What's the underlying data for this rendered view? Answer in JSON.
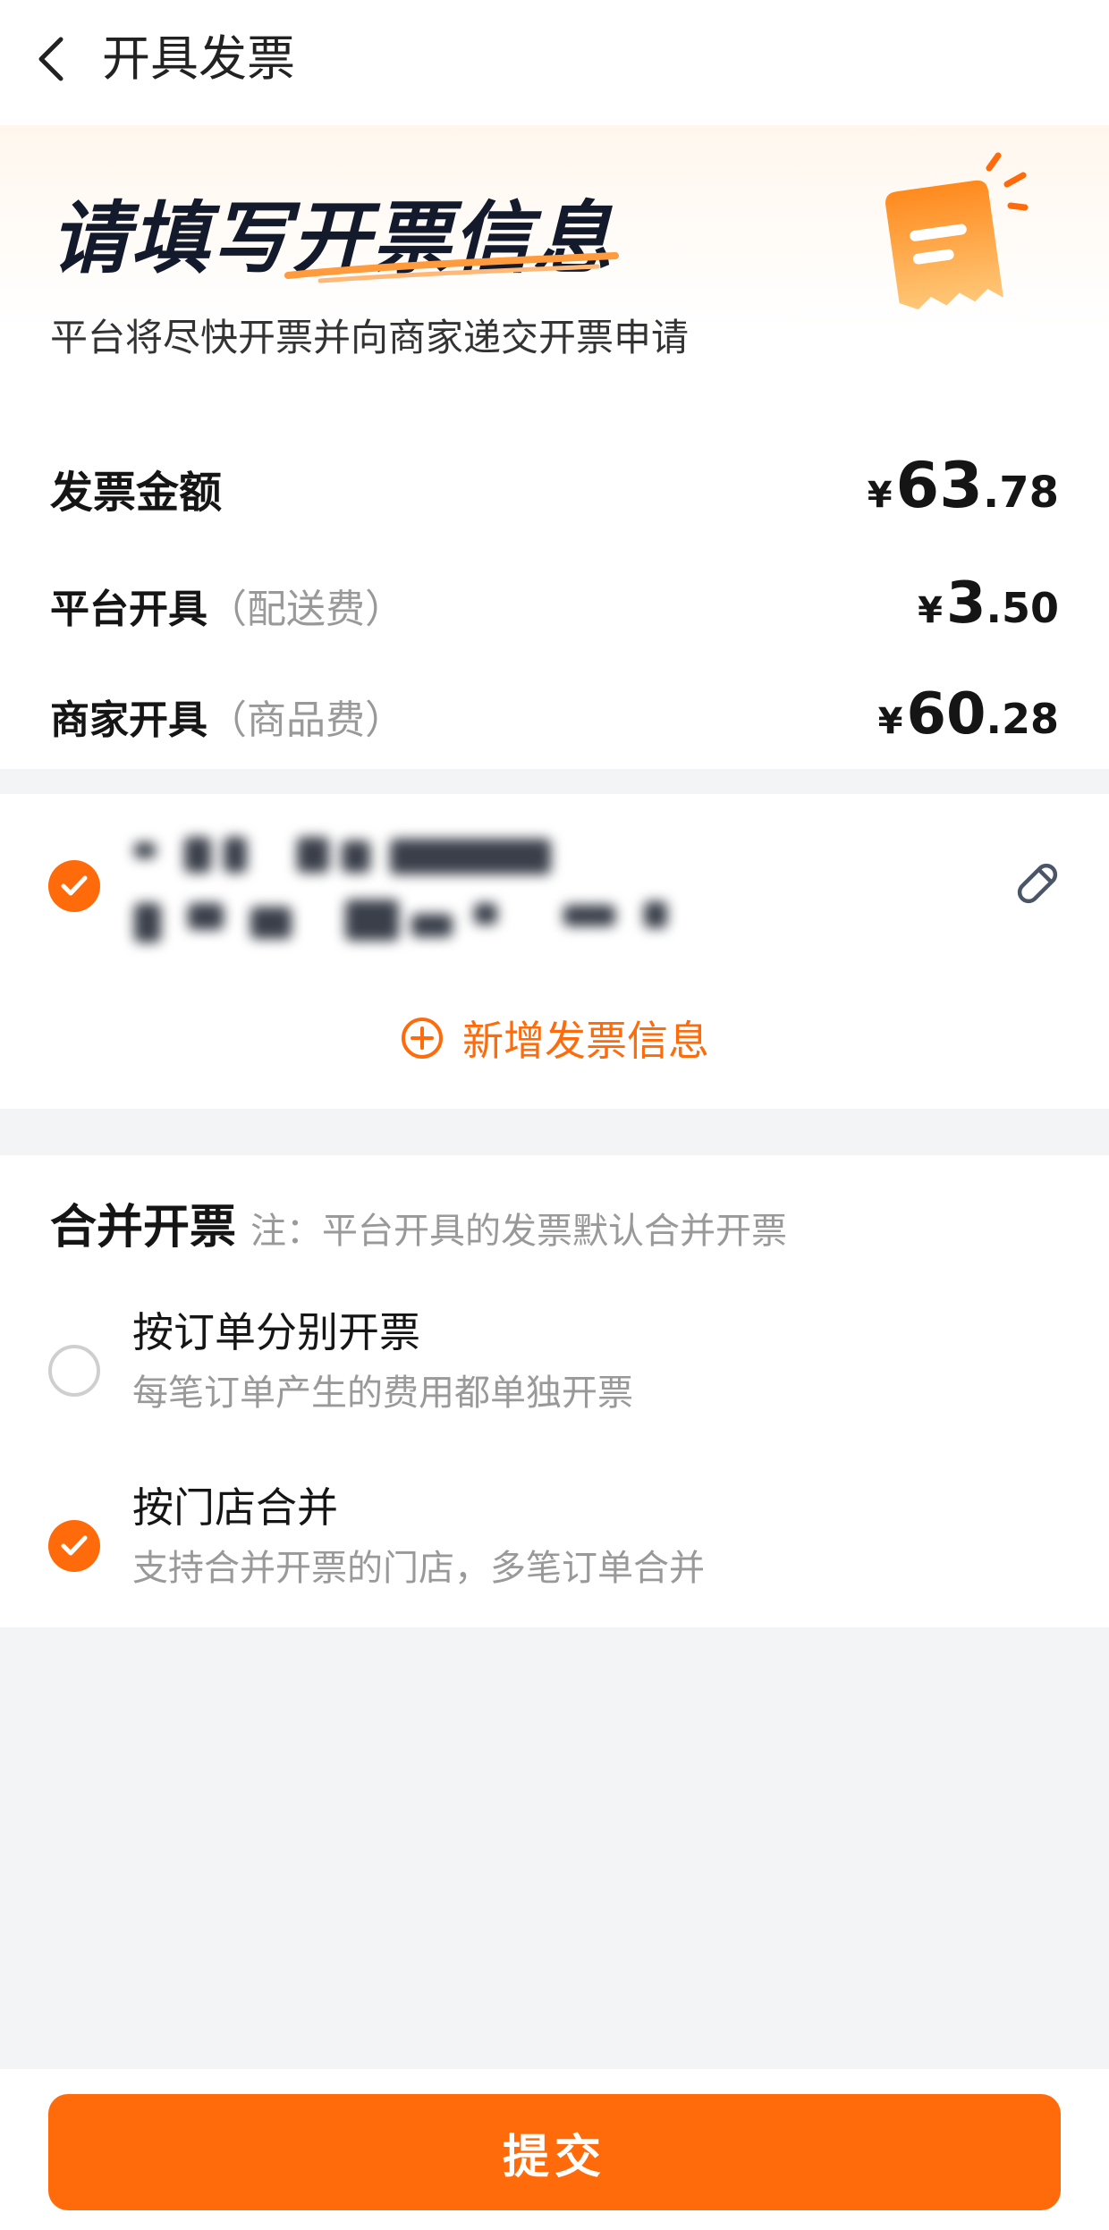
{
  "header": {
    "title": "开具发票"
  },
  "intro": {
    "headline": "请填写开票信息",
    "subtitle": "平台将尽快开票并向商家递交开票申请"
  },
  "amounts": {
    "currency": "¥",
    "total": {
      "label": "发票金额",
      "int": "63",
      "dec": ".78"
    },
    "platform": {
      "label": "平台开具",
      "note": "（配送费）",
      "int": "3",
      "dec": ".50"
    },
    "merchant": {
      "label": "商家开具",
      "note": "（商品费）",
      "int": "60",
      "dec": ".28"
    }
  },
  "invoice_info": {
    "add_label": "新增发票信息"
  },
  "merge": {
    "title": "合并开票",
    "note": "注：平台开具的发票默认合并开票",
    "options": [
      {
        "title": "按订单分别开票",
        "desc": "每笔订单产生的费用都单独开票",
        "selected": false
      },
      {
        "title": "按门店合并",
        "desc": "支持合并开票的门店，多笔订单合并",
        "selected": true
      }
    ]
  },
  "submit_label": "提交",
  "colors": {
    "accent": "#ff6a0a",
    "background": "#f3f4f6"
  },
  "icons": [
    "back-arrow-icon",
    "document-illustration-icon",
    "checkmark-icon",
    "edit-pencil-icon",
    "add-circle-icon"
  ]
}
